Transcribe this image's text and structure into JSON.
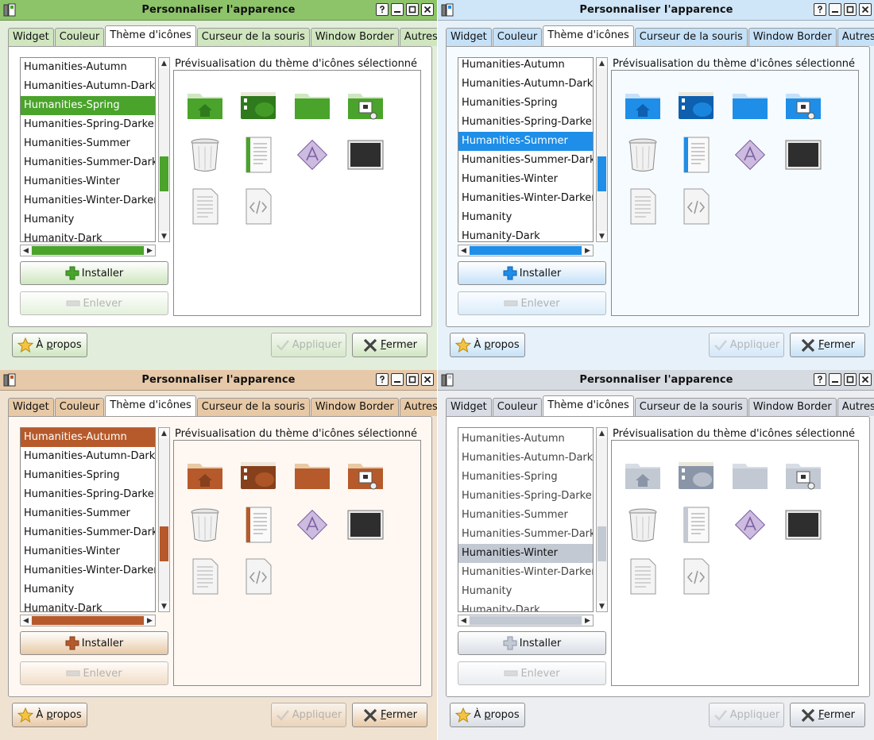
{
  "window": {
    "title": "Personnaliser l'apparence",
    "tabs": [
      "Widget",
      "Couleur",
      "Thème d'icônes",
      "Curseur de la souris",
      "Window Border",
      "Autres"
    ],
    "active_tab": "Thème d'icônes",
    "preview_label": "Prévisualisation du thème d'icônes sélectionné",
    "buttons": {
      "install": "Installer",
      "remove": "Enlever",
      "about": "À propos",
      "apply": "Appliquer",
      "close": "Fermer"
    }
  },
  "variants": [
    {
      "name": "green",
      "first_item": 0,
      "selected": "Humanities-Spring",
      "colors": {
        "title": "#8dc46a",
        "chrome": "#e3eddc",
        "accent": "#4aa32b",
        "light": "#cfe6bf",
        "dark": "#2f7a1c",
        "paper": "#ffffff"
      }
    },
    {
      "name": "blue",
      "first_item": 0,
      "selected": "Humanities-Summer",
      "colors": {
        "title": "#cfe6f8",
        "chrome": "#e7f1fa",
        "accent": "#1e8ee8",
        "light": "#c5e1f8",
        "dark": "#0e5fae",
        "paper": "#f6fbff"
      }
    },
    {
      "name": "orange",
      "first_item": 0,
      "selected": "Humanities-Autumn",
      "colors": {
        "title": "#e6c9a9",
        "chrome": "#f0e2d1",
        "accent": "#b65a2b",
        "light": "#e8c9a6",
        "dark": "#86401c",
        "paper": "#fff8f2"
      }
    },
    {
      "name": "gray",
      "first_item": 0,
      "selected": "Humanities-Winter",
      "colors": {
        "title": "#d6dbe2",
        "chrome": "#eceef1",
        "accent": "#c3c9d3",
        "light": "#d8dde5",
        "dark": "#8a96a8",
        "paper": "#ffffff"
      }
    }
  ],
  "theme_list": [
    "Humanities-Autumn",
    "Humanities-Autumn-Darker",
    "Humanities-Spring",
    "Humanities-Spring-Darker",
    "Humanities-Summer",
    "Humanities-Summer-Darker",
    "Humanities-Winter",
    "Humanities-Winter-Darker",
    "Humanity",
    "Humanity-Dark"
  ],
  "preview_icons": [
    "home-folder-icon",
    "desktop-folder-icon",
    "folder-icon",
    "remote-folder-icon",
    "trash-icon",
    "document-icon",
    "font-icon",
    "terminal-icon",
    "text-file-icon",
    "code-file-icon"
  ]
}
